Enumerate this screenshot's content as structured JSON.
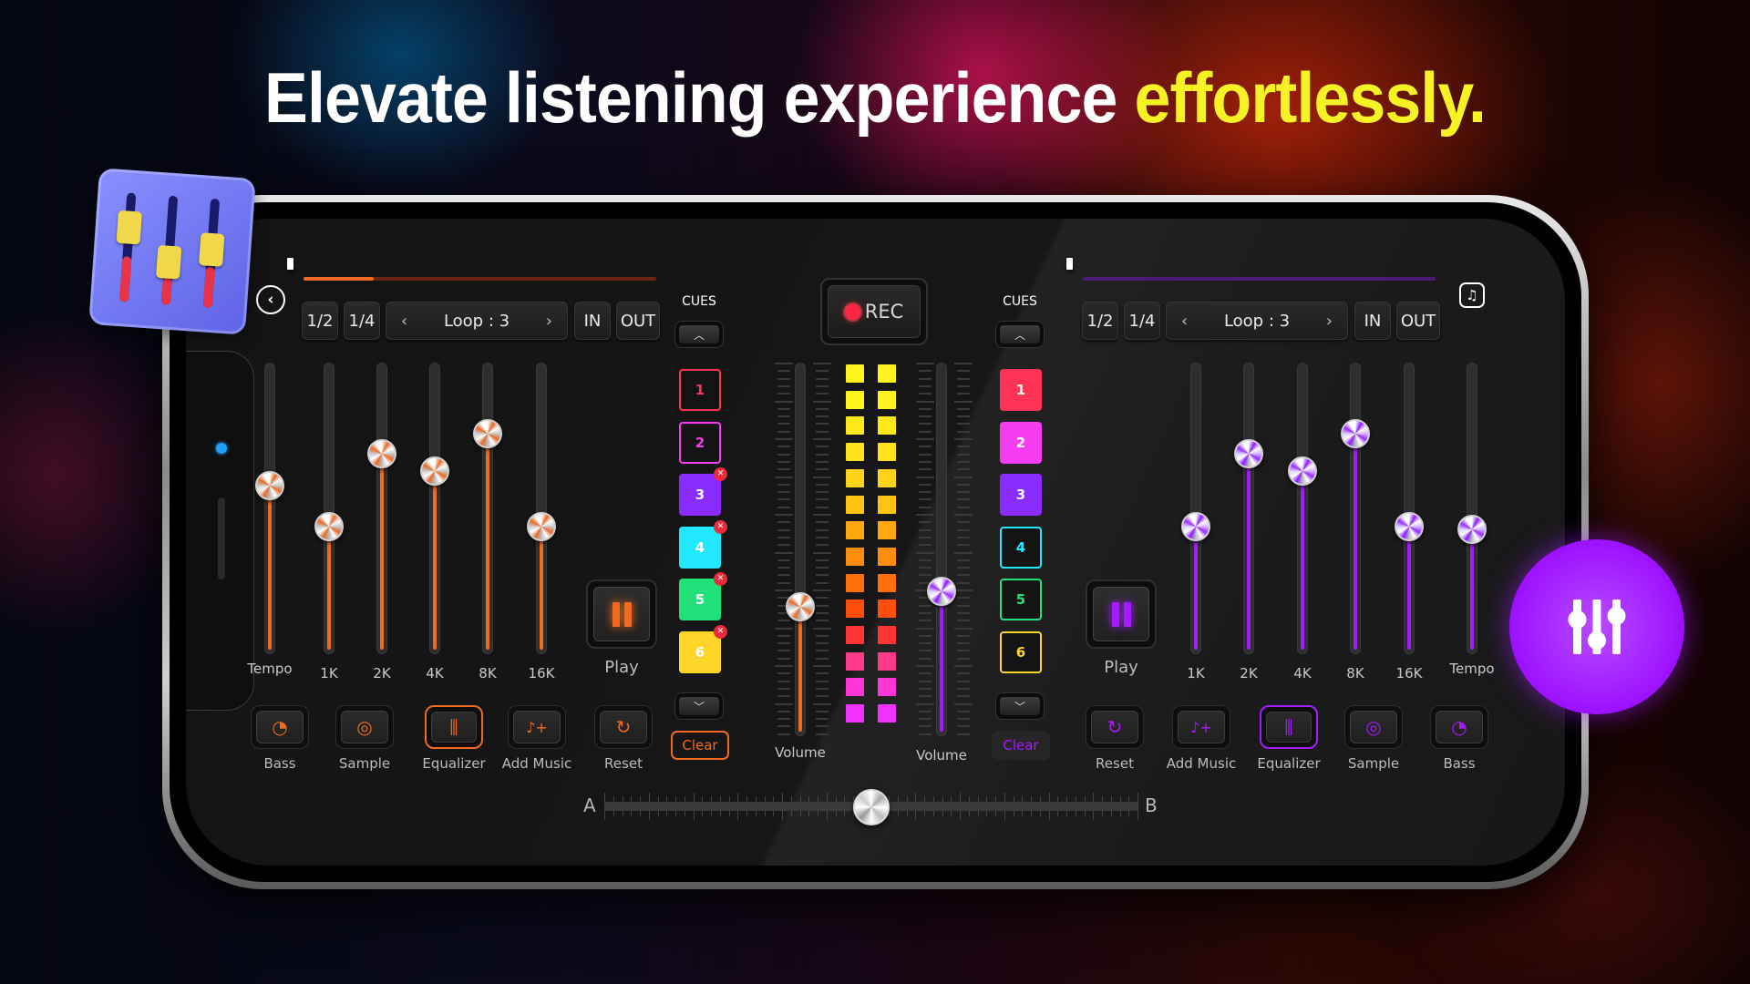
{
  "headline": {
    "text": "Elevate listening experience ",
    "highlight": "effortlessly."
  },
  "colors": {
    "deck_a_accent": "#f06a1f",
    "deck_b_accent": "#a51bff",
    "highlight_yellow": "#f7f224",
    "rec_red": "#ff2443"
  },
  "icons": {
    "back": "‹",
    "music_note": "♫",
    "chevron_left": "‹",
    "chevron_right": "›",
    "chevron_up": "︿",
    "chevron_down": "﹀",
    "close": "✕",
    "bass": "◔",
    "sample": "◎",
    "equalizer": "⫼",
    "add_music": "♪+",
    "reset": "↻"
  },
  "deck_a": {
    "track_progress": 0.2,
    "controls": {
      "half": "1/2",
      "quarter": "1/4",
      "loop": "Loop : 3",
      "in": "IN",
      "out": "OUT"
    },
    "sliders": [
      {
        "label": "Tempo",
        "value": 0.58
      },
      {
        "label": "1K",
        "value": 0.44
      },
      {
        "label": "2K",
        "value": 0.69
      },
      {
        "label": "4K",
        "value": 0.63
      },
      {
        "label": "8K",
        "value": 0.76
      },
      {
        "label": "16K",
        "value": 0.44
      }
    ],
    "play_label": "Play",
    "fx": [
      {
        "label": "Bass",
        "icon": "bass",
        "active": false
      },
      {
        "label": "Sample",
        "icon": "sample",
        "active": false
      },
      {
        "label": "Equalizer",
        "icon": "equalizer",
        "active": true
      },
      {
        "label": "Add Music",
        "icon": "add_music",
        "active": false
      },
      {
        "label": "Reset",
        "icon": "reset",
        "active": false
      }
    ],
    "cues_label": "CUES",
    "cues": [
      {
        "n": "1",
        "color": "#ff3355",
        "set": false
      },
      {
        "n": "2",
        "color": "#f63cf0",
        "set": false
      },
      {
        "n": "3",
        "color": "#8a2bff",
        "set": true
      },
      {
        "n": "4",
        "color": "#22e8ff",
        "set": true
      },
      {
        "n": "5",
        "color": "#22e07a",
        "set": true
      },
      {
        "n": "6",
        "color": "#ffd52a",
        "set": true
      }
    ],
    "clear_label": "Clear",
    "volume_label": "Volume",
    "volume": 0.35
  },
  "deck_b": {
    "track_progress": 0.0,
    "controls": {
      "half": "1/2",
      "quarter": "1/4",
      "loop": "Loop : 3",
      "in": "IN",
      "out": "OUT"
    },
    "sliders": [
      {
        "label": "1K",
        "value": 0.44
      },
      {
        "label": "2K",
        "value": 0.69
      },
      {
        "label": "4K",
        "value": 0.63
      },
      {
        "label": "8K",
        "value": 0.76
      },
      {
        "label": "16K",
        "value": 0.44
      },
      {
        "label": "Tempo",
        "value": 0.43
      }
    ],
    "play_label": "Play",
    "fx": [
      {
        "label": "Reset",
        "icon": "reset",
        "active": false
      },
      {
        "label": "Add Music",
        "icon": "add_music",
        "active": false
      },
      {
        "label": "Equalizer",
        "icon": "equalizer",
        "active": true
      },
      {
        "label": "Sample",
        "icon": "sample",
        "active": false
      },
      {
        "label": "Bass",
        "icon": "bass",
        "active": false
      }
    ],
    "cues_label": "CUES",
    "cues": [
      {
        "n": "1",
        "color": "#ff3355",
        "set": true
      },
      {
        "n": "2",
        "color": "#f63cf0",
        "set": true
      },
      {
        "n": "3",
        "color": "#8a2bff",
        "set": true
      },
      {
        "n": "4",
        "color": "#22e8ff",
        "set": false
      },
      {
        "n": "5",
        "color": "#22e07a",
        "set": false
      },
      {
        "n": "6",
        "color": "#ffd52a",
        "set": false
      }
    ],
    "clear_label": "Clear",
    "volume_label": "Volume",
    "volume": 0.39
  },
  "mixer": {
    "rec_label": "REC",
    "vu_colors": [
      "#fff21d",
      "#fff21d",
      "#ffe81a",
      "#ffe21c",
      "#ffd418",
      "#ffc312",
      "#ffa80e",
      "#ff8d0c",
      "#ff700a",
      "#ff4e0e",
      "#ff3535",
      "#ff3a8a",
      "#ff35d8",
      "#f032ff"
    ],
    "crossfader": {
      "left": "A",
      "right": "B",
      "position": 0.5
    }
  }
}
